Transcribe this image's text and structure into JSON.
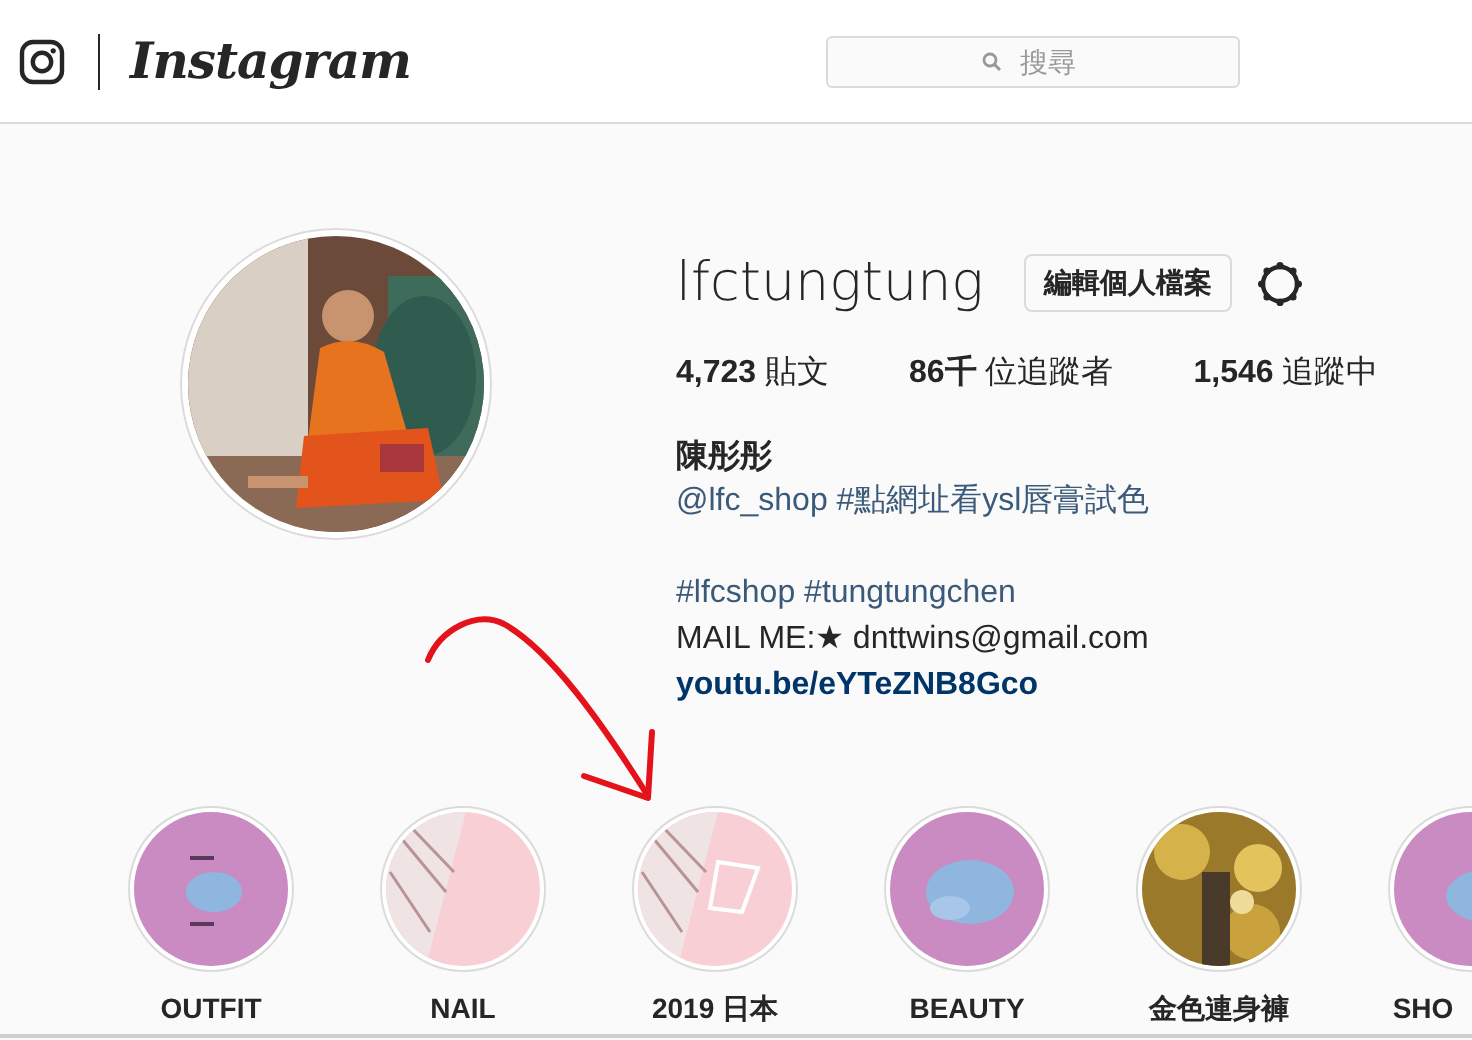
{
  "header": {
    "logo_text": "Instagram",
    "search": {
      "placeholder": "搜尋"
    }
  },
  "profile": {
    "username": "lfctungtung",
    "edit_button": "編輯個人檔案",
    "stats": [
      "**4,723** 貼文",
      "**86千** 位追蹤者",
      "**1,546** 追蹤中"
    ],
    "name": "陳彤彤",
    "bio": [
      {
        "lines": [
          {
            "text": "@lfc_shop #點網址看ysl唇膏試色",
            "kind": "tag"
          }
        ]
      },
      {
        "lines": [
          {
            "text": "#lfcshop #tungtungchen",
            "kind": "tag"
          },
          {
            "text": "MAIL ME:★ dnttwins@gmail.com",
            "kind": "plain"
          },
          {
            "text": "youtu.be/eYTeZNB8Gco",
            "kind": "url"
          }
        ]
      }
    ]
  },
  "highlights": [
    {
      "label": "OUTFIT"
    },
    {
      "label": "NAIL"
    },
    {
      "label": "2019 日本"
    },
    {
      "label": "BEAUTY"
    },
    {
      "label": "金色連身褲"
    },
    {
      "label": "SHO"
    }
  ]
}
